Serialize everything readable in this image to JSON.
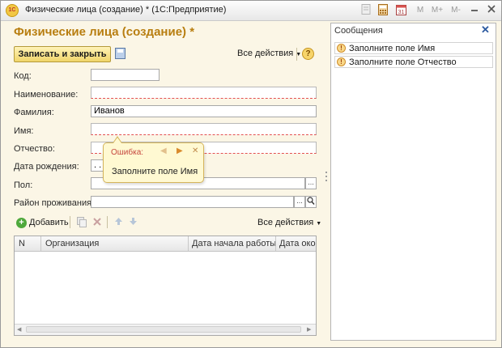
{
  "window": {
    "title": "Физические лица (создание) * (1С:Предприятие)",
    "app_logo_text": "1С",
    "toolbar_icons": [
      "document-icon",
      "calculator-icon",
      "calendar-icon"
    ],
    "memory_buttons": {
      "m": "M",
      "m_plus": "M+",
      "m_minus": "M-"
    }
  },
  "form": {
    "title": "Физические лица (создание) *",
    "save_close_label": "Записать и закрыть",
    "all_actions_label": "Все действия",
    "help_label": "?",
    "fields": {
      "code": {
        "label": "Код:",
        "value": ""
      },
      "name": {
        "label": "Наименование:",
        "value": ""
      },
      "last_name": {
        "label": "Фамилия:",
        "value": "Иванов"
      },
      "first_name": {
        "label": "Имя:",
        "value": ""
      },
      "patronymic": {
        "label": "Отчество:",
        "value": ""
      },
      "birth_date": {
        "label": "Дата рождения:",
        "value": ". ."
      },
      "gender": {
        "label": "Пол:",
        "value": ""
      },
      "district": {
        "label": "Район проживания:",
        "value": ""
      }
    },
    "error_tooltip": {
      "title": "Ошибка:",
      "text": "Заполните поле Имя"
    },
    "table": {
      "add_label": "Добавить",
      "all_actions_label": "Все действия",
      "columns": [
        "N",
        "Организация",
        "Дата начала работы",
        "Дата окон"
      ],
      "rows": []
    }
  },
  "messages": {
    "title": "Сообщения",
    "items": [
      {
        "text": "Заполните поле Имя"
      },
      {
        "text": "Заполните поле Отчество"
      }
    ]
  },
  "colors": {
    "form_title": "#b87e10",
    "window_bg": "#fbf6e6",
    "error_underline": "#e35050",
    "tooltip_bg": "#fff9d2",
    "tooltip_title": "#c5463d"
  }
}
